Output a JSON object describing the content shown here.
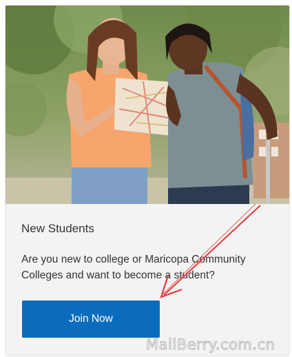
{
  "card": {
    "image_alt": "Two students holding a map",
    "title": "New Students",
    "description": "Are you new to college or Maricopa Community Colleges and want to become a student?",
    "cta_label": "Join Now"
  },
  "watermark": "MailBerry.com.cn",
  "colors": {
    "button": "#0b6cbd",
    "annotation_arrow": "#e03b3b",
    "card_background": "#f3f3f3"
  }
}
